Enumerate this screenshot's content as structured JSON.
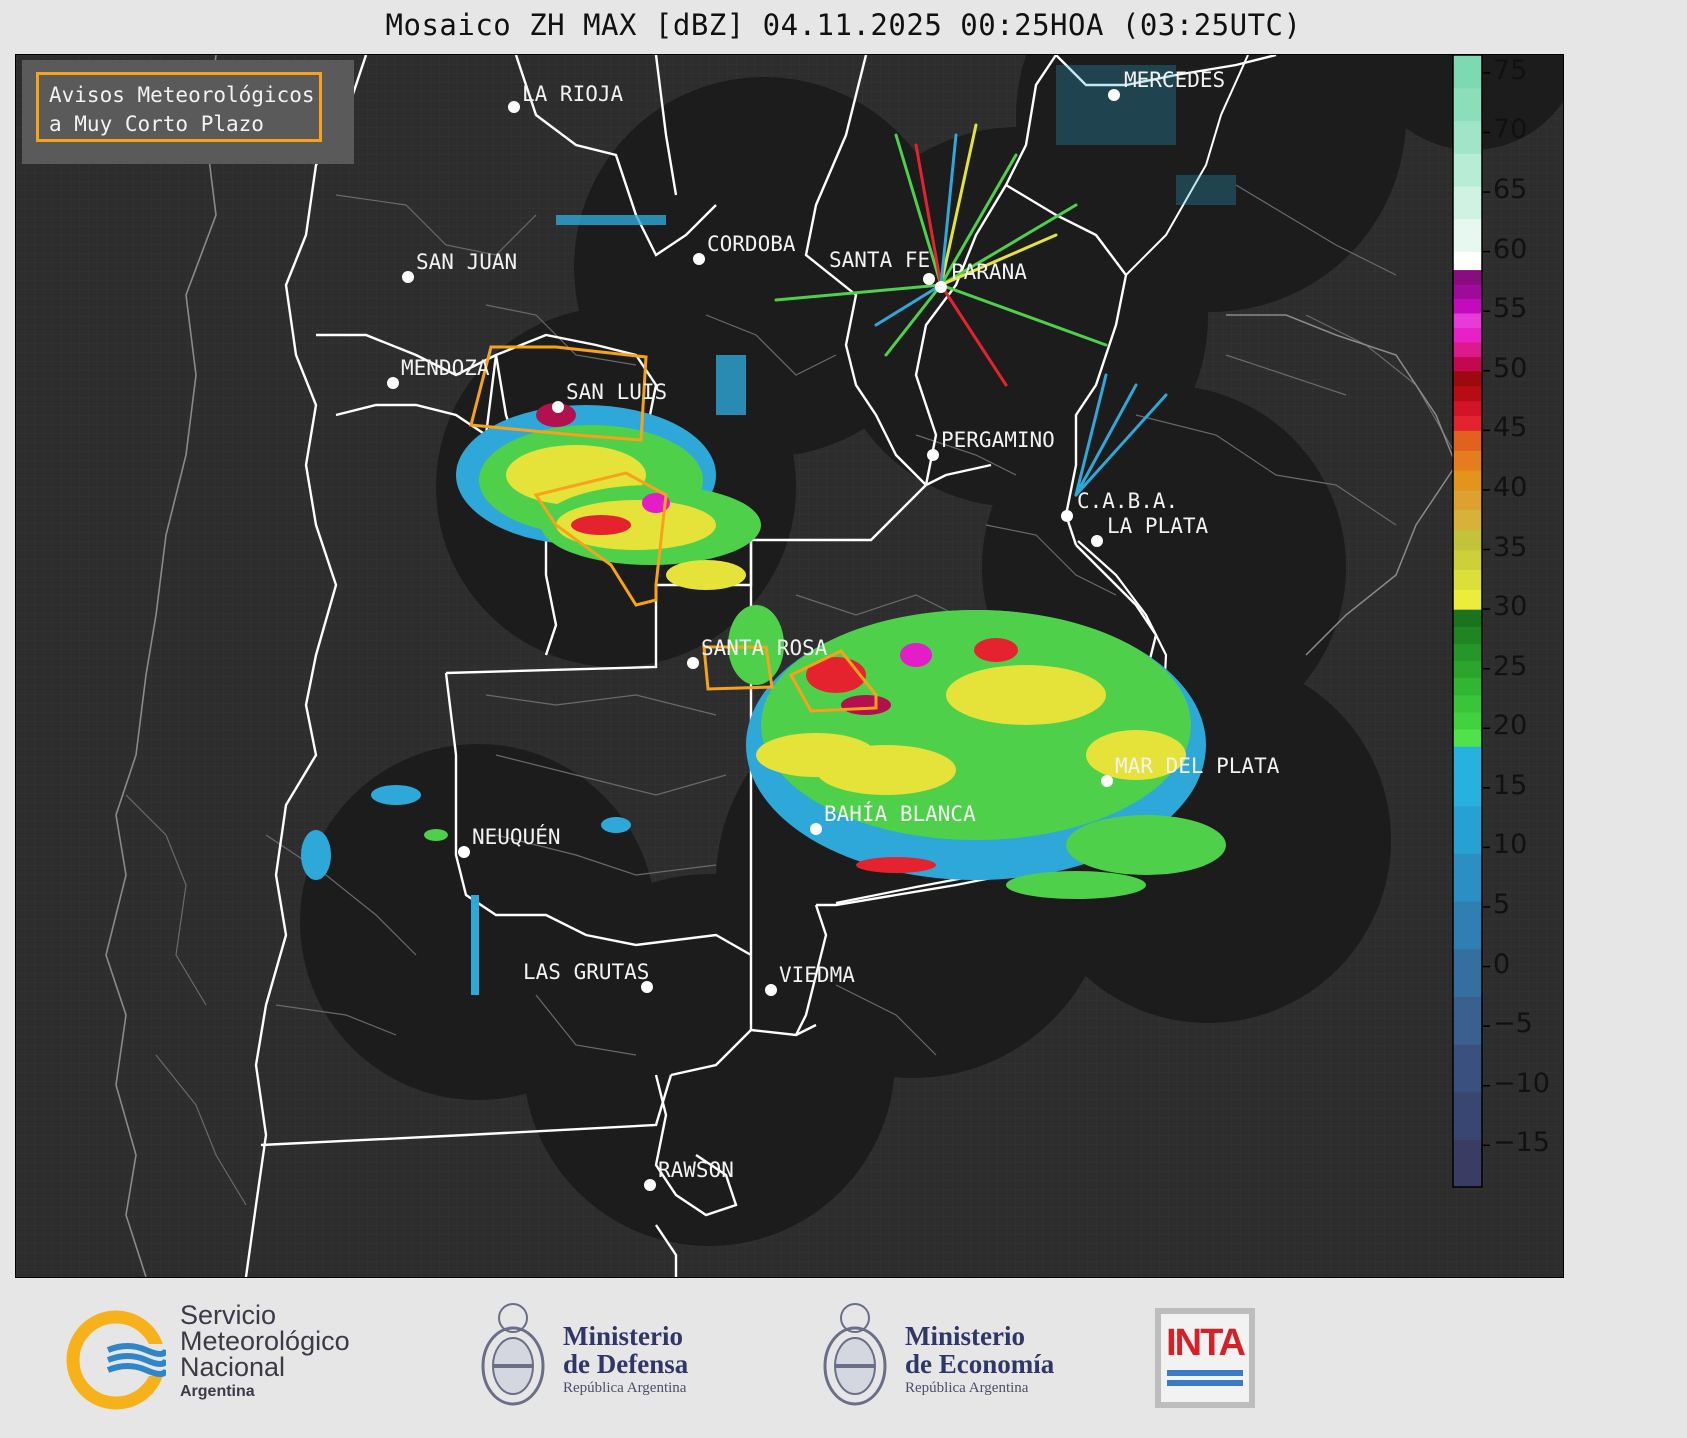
{
  "title": "Mosaico ZH MAX [dBZ] 04.11.2025 00:25HOA (03:25UTC)",
  "legend": {
    "line1": "Avisos Meteorológicos",
    "line2": "a Muy Corto Plazo",
    "color": "#f7a21b"
  },
  "cities": [
    {
      "name": "LA RIOJA"
    },
    {
      "name": "MERCEDES"
    },
    {
      "name": "SAN JUAN"
    },
    {
      "name": "CORDOBA"
    },
    {
      "name": "SANTA FE"
    },
    {
      "name": "PARANA"
    },
    {
      "name": "MENDOZA"
    },
    {
      "name": "SAN LUIS"
    },
    {
      "name": "PERGAMINO"
    },
    {
      "name": "C.A.B.A."
    },
    {
      "name": "LA PLATA"
    },
    {
      "name": "SANTA ROSA"
    },
    {
      "name": "MAR DEL PLATA"
    },
    {
      "name": "BAHÍA BLANCA"
    },
    {
      "name": "NEUQUÉN"
    },
    {
      "name": "LAS GRUTAS"
    },
    {
      "name": "VIEDMA"
    },
    {
      "name": "RAWSON"
    }
  ],
  "colorbar": {
    "ticks": [
      "75",
      "70",
      "65",
      "60",
      "55",
      "50",
      "45",
      "40",
      "35",
      "30",
      "25",
      "20",
      "15",
      "10",
      "5",
      "0",
      "−5",
      "−10",
      "−15"
    ],
    "min": -18.5,
    "max": 76.5,
    "stops": [
      {
        "from": -18.5,
        "to": 30,
        "color": "gradient-blue"
      },
      {
        "from": 30,
        "to": 40,
        "color": "yellow"
      },
      {
        "from": 40,
        "to": 45,
        "color": "orange"
      },
      {
        "from": 45,
        "to": 50,
        "color": "red"
      },
      {
        "from": 50,
        "to": 58.5,
        "color": "magenta"
      },
      {
        "from": 58.5,
        "to": 76.5,
        "color": "mint"
      }
    ]
  },
  "logos": {
    "smn": {
      "line1": "Servicio",
      "line2": "Meteorológico",
      "line3": "Nacional",
      "line4": "Argentina"
    },
    "defensa": {
      "line1": "Ministerio",
      "line2": "de Defensa",
      "line3": "República Argentina"
    },
    "economia": {
      "line1": "Ministerio",
      "line2": "de Economía",
      "line3": "República Argentina"
    },
    "inta": {
      "text": "INTA"
    }
  }
}
